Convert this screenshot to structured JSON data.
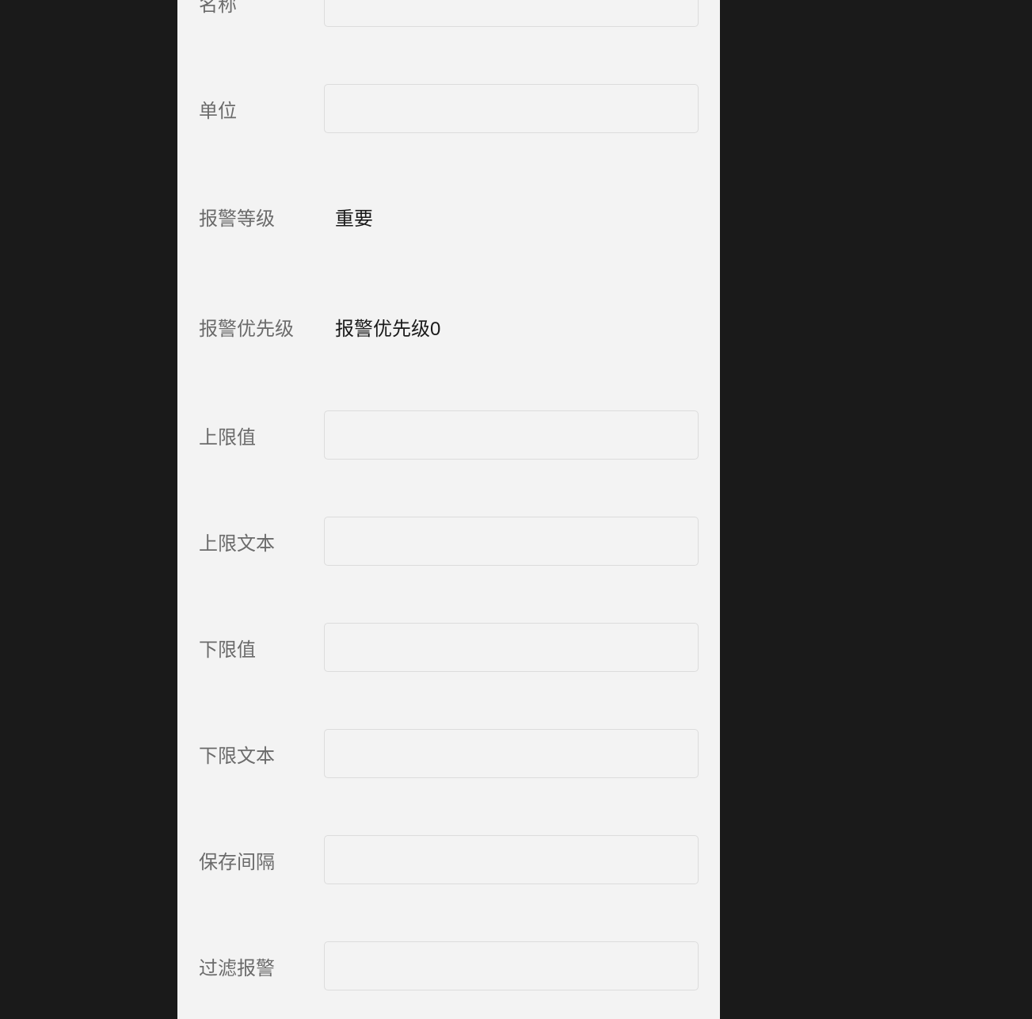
{
  "form": {
    "name": {
      "label": "名称",
      "value": ""
    },
    "unit": {
      "label": "单位",
      "value": ""
    },
    "alarm_level": {
      "label": "报警等级",
      "value": "重要"
    },
    "alarm_priority": {
      "label": "报警优先级",
      "value": "报警优先级0"
    },
    "upper_limit": {
      "label": "上限值",
      "value": ""
    },
    "upper_text": {
      "label": "上限文本",
      "value": ""
    },
    "lower_limit": {
      "label": "下限值",
      "value": ""
    },
    "lower_text": {
      "label": "下限文本",
      "value": ""
    },
    "save_interval": {
      "label": "保存间隔",
      "value": ""
    },
    "filter_alarm": {
      "label": "过滤报警",
      "value": ""
    }
  }
}
